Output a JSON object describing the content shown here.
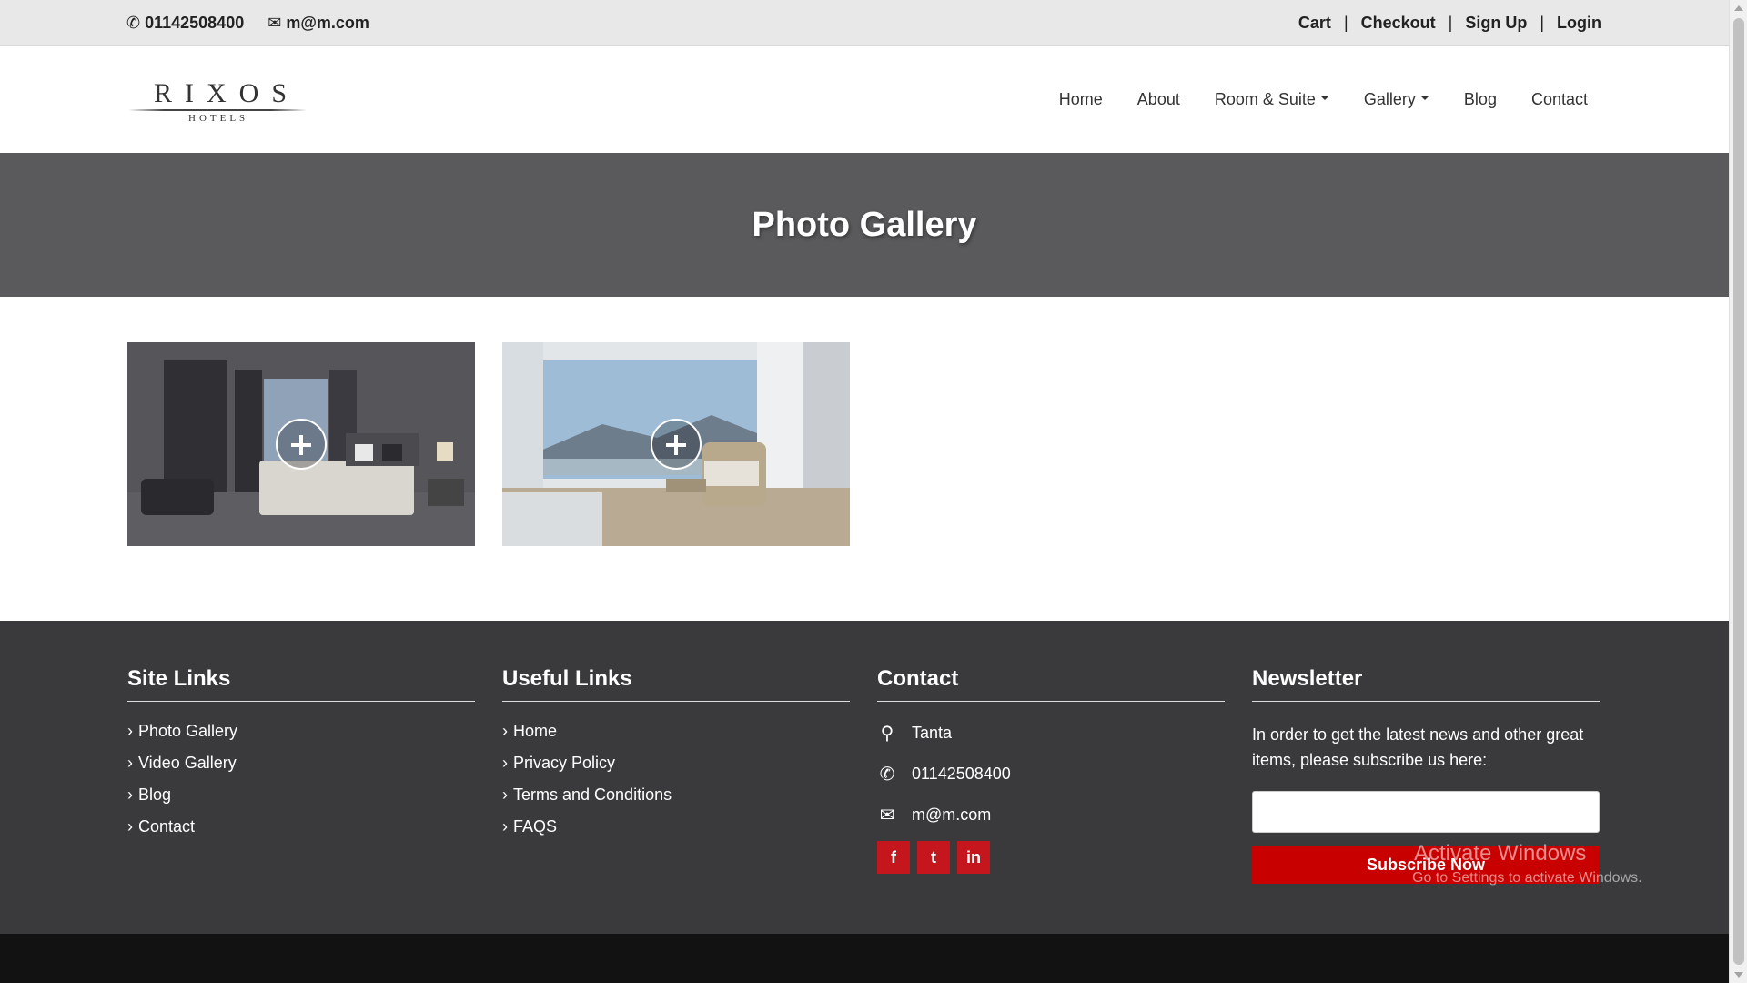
{
  "topbar": {
    "phone": "01142508400",
    "email": "m@m.com",
    "links": [
      "Cart",
      "Checkout",
      "Sign Up",
      "Login"
    ],
    "separator": "|"
  },
  "header": {
    "logo_brand": "RIXOS",
    "logo_sub": "HOTELS",
    "nav": {
      "home": "Home",
      "about": "About",
      "rooms": "Room & Suite",
      "gallery": "Gallery",
      "blog": "Blog",
      "contact": "Contact"
    }
  },
  "banner": {
    "title": "Photo Gallery"
  },
  "gallery": {
    "items": [
      {
        "subject": "bedroom"
      },
      {
        "subject": "room-with-view"
      }
    ]
  },
  "footer": {
    "site_links": {
      "heading": "Site Links",
      "items": [
        "Photo Gallery",
        "Video Gallery",
        "Blog",
        "Contact"
      ]
    },
    "useful_links": {
      "heading": "Useful Links",
      "items": [
        "Home",
        "Privacy Policy",
        "Terms and Conditions",
        "FAQS"
      ]
    },
    "contact": {
      "heading": "Contact",
      "address": "Tanta",
      "phone": "01142508400",
      "email": "m@m.com",
      "socials": [
        "f",
        "t",
        "in"
      ]
    },
    "newsletter": {
      "heading": "Newsletter",
      "text": "In order to get the latest news and other great items, please subscribe us here:",
      "input_value": "",
      "button": "Subscribe Now"
    }
  },
  "watermark": {
    "line1": "Activate Windows",
    "line2": "Go to Settings to activate Windows."
  },
  "colors": {
    "accent": "#c80000",
    "banner": "#5a5a5c",
    "footer": "#3a3a3c"
  }
}
